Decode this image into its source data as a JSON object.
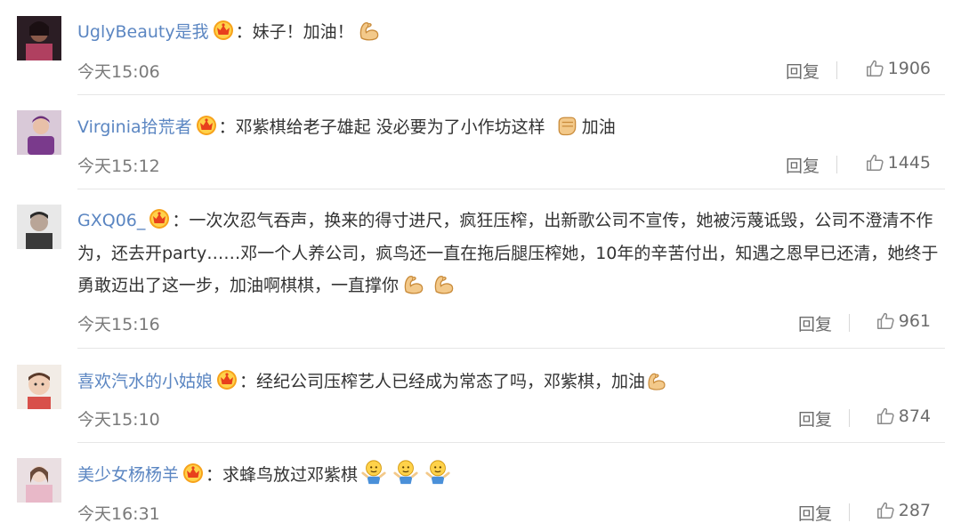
{
  "comments": [
    {
      "user": "UglyBeauty是我",
      "text": "：妹子！加油！",
      "time": "今天15:06",
      "reply": "回复",
      "likes": "1906"
    },
    {
      "user": "Virginia拾荒者",
      "text": "：邓紫棋给老子雄起 没必要为了小作坊这样",
      "text_after": "加油",
      "time": "今天15:12",
      "reply": "回复",
      "likes": "1445"
    },
    {
      "user": "GXQ06_",
      "text": "：一次次忍气吞声，换来的得寸进尺，疯狂压榨，出新歌公司不宣传，她被污蔑诋毁，公司不澄清不作为，还去开party……邓一个人养公司，疯鸟还一直在拖后腿压榨她，10年的辛苦付出，知遇之恩早已还清，她终于勇敢迈出了这一步，加油啊棋棋，一直撑你",
      "time": "今天15:16",
      "reply": "回复",
      "likes": "961"
    },
    {
      "user": "喜欢汽水的小姑娘",
      "text": "：经纪公司压榨艺人已经成为常态了吗，邓紫棋，加油",
      "time": "今天15:10",
      "reply": "回复",
      "likes": "874"
    },
    {
      "user": "美少女杨杨羊",
      "text": "：求蜂鸟放过邓紫棋",
      "time": "今天16:31",
      "reply": "回复",
      "likes": "287"
    }
  ],
  "icons": {
    "badge": "crown-badge-icon",
    "like": "thumbs-up-icon",
    "emoji_muscle": "flexed-biceps-emoji",
    "emoji_fist": "raised-fist-emoji",
    "emoji_shrug": "shrug-emoji"
  },
  "colors": {
    "username": "#5b86c2",
    "text": "#333333",
    "meta": "#7a7a7a",
    "divider": "#e6e6e6",
    "badge": "#f5a623"
  }
}
